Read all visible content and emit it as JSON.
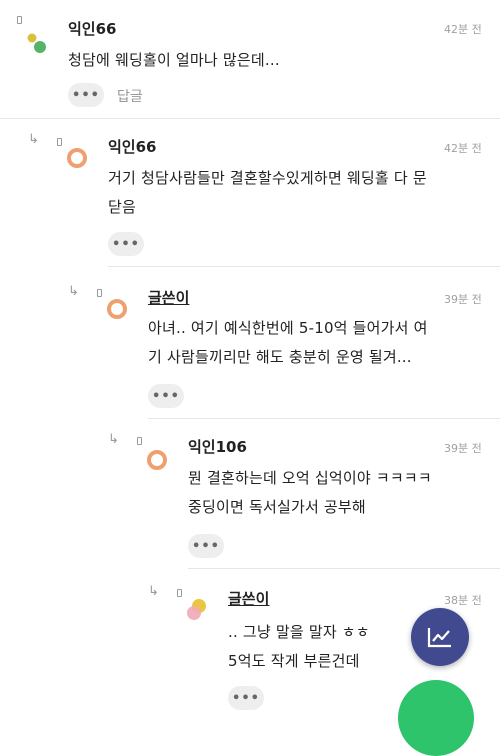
{
  "comments": [
    {
      "author": "익인66",
      "time": "42분 전",
      "lines": [
        "청담에 웨딩홀이 얼마나 많은데..."
      ],
      "more": "•••",
      "reply": "답글"
    },
    {
      "author": "익인66",
      "time": "42분 전",
      "lines": [
        "거기 청담사람들만 결혼할수있게하면 웨딩홀 다 문",
        "닫음"
      ],
      "more": "•••"
    },
    {
      "author": "글쓴이",
      "time": "39분 전",
      "lines": [
        "아녀.. 여기 예식한번에 5-10억 들어가서 여",
        "기 사람들끼리만 해도 충분히 운영 될겨..."
      ],
      "more": "•••"
    },
    {
      "author": "익인106",
      "time": "39분 전",
      "lines": [
        "뭔 결혼하는데 오억 십억이야 ㅋㅋㅋㅋ",
        "중딩이면 독서실가서 공부해"
      ],
      "more": "•••"
    },
    {
      "author": "글쓴이",
      "time": "38분 전",
      "lines": [
        ".. 그냥 말을 말자 ㅎㅎ",
        "5억도 작게 부른건데"
      ],
      "more": "•••"
    }
  ],
  "reply_arrow": "↳",
  "fab": {
    "icon": "trend-chart-icon"
  },
  "colors": {
    "fab_chart": "#424a8f",
    "fab_green": "#2ec46b",
    "avatar_orange": "#f0a070",
    "avatar_green": "#58b36a"
  }
}
